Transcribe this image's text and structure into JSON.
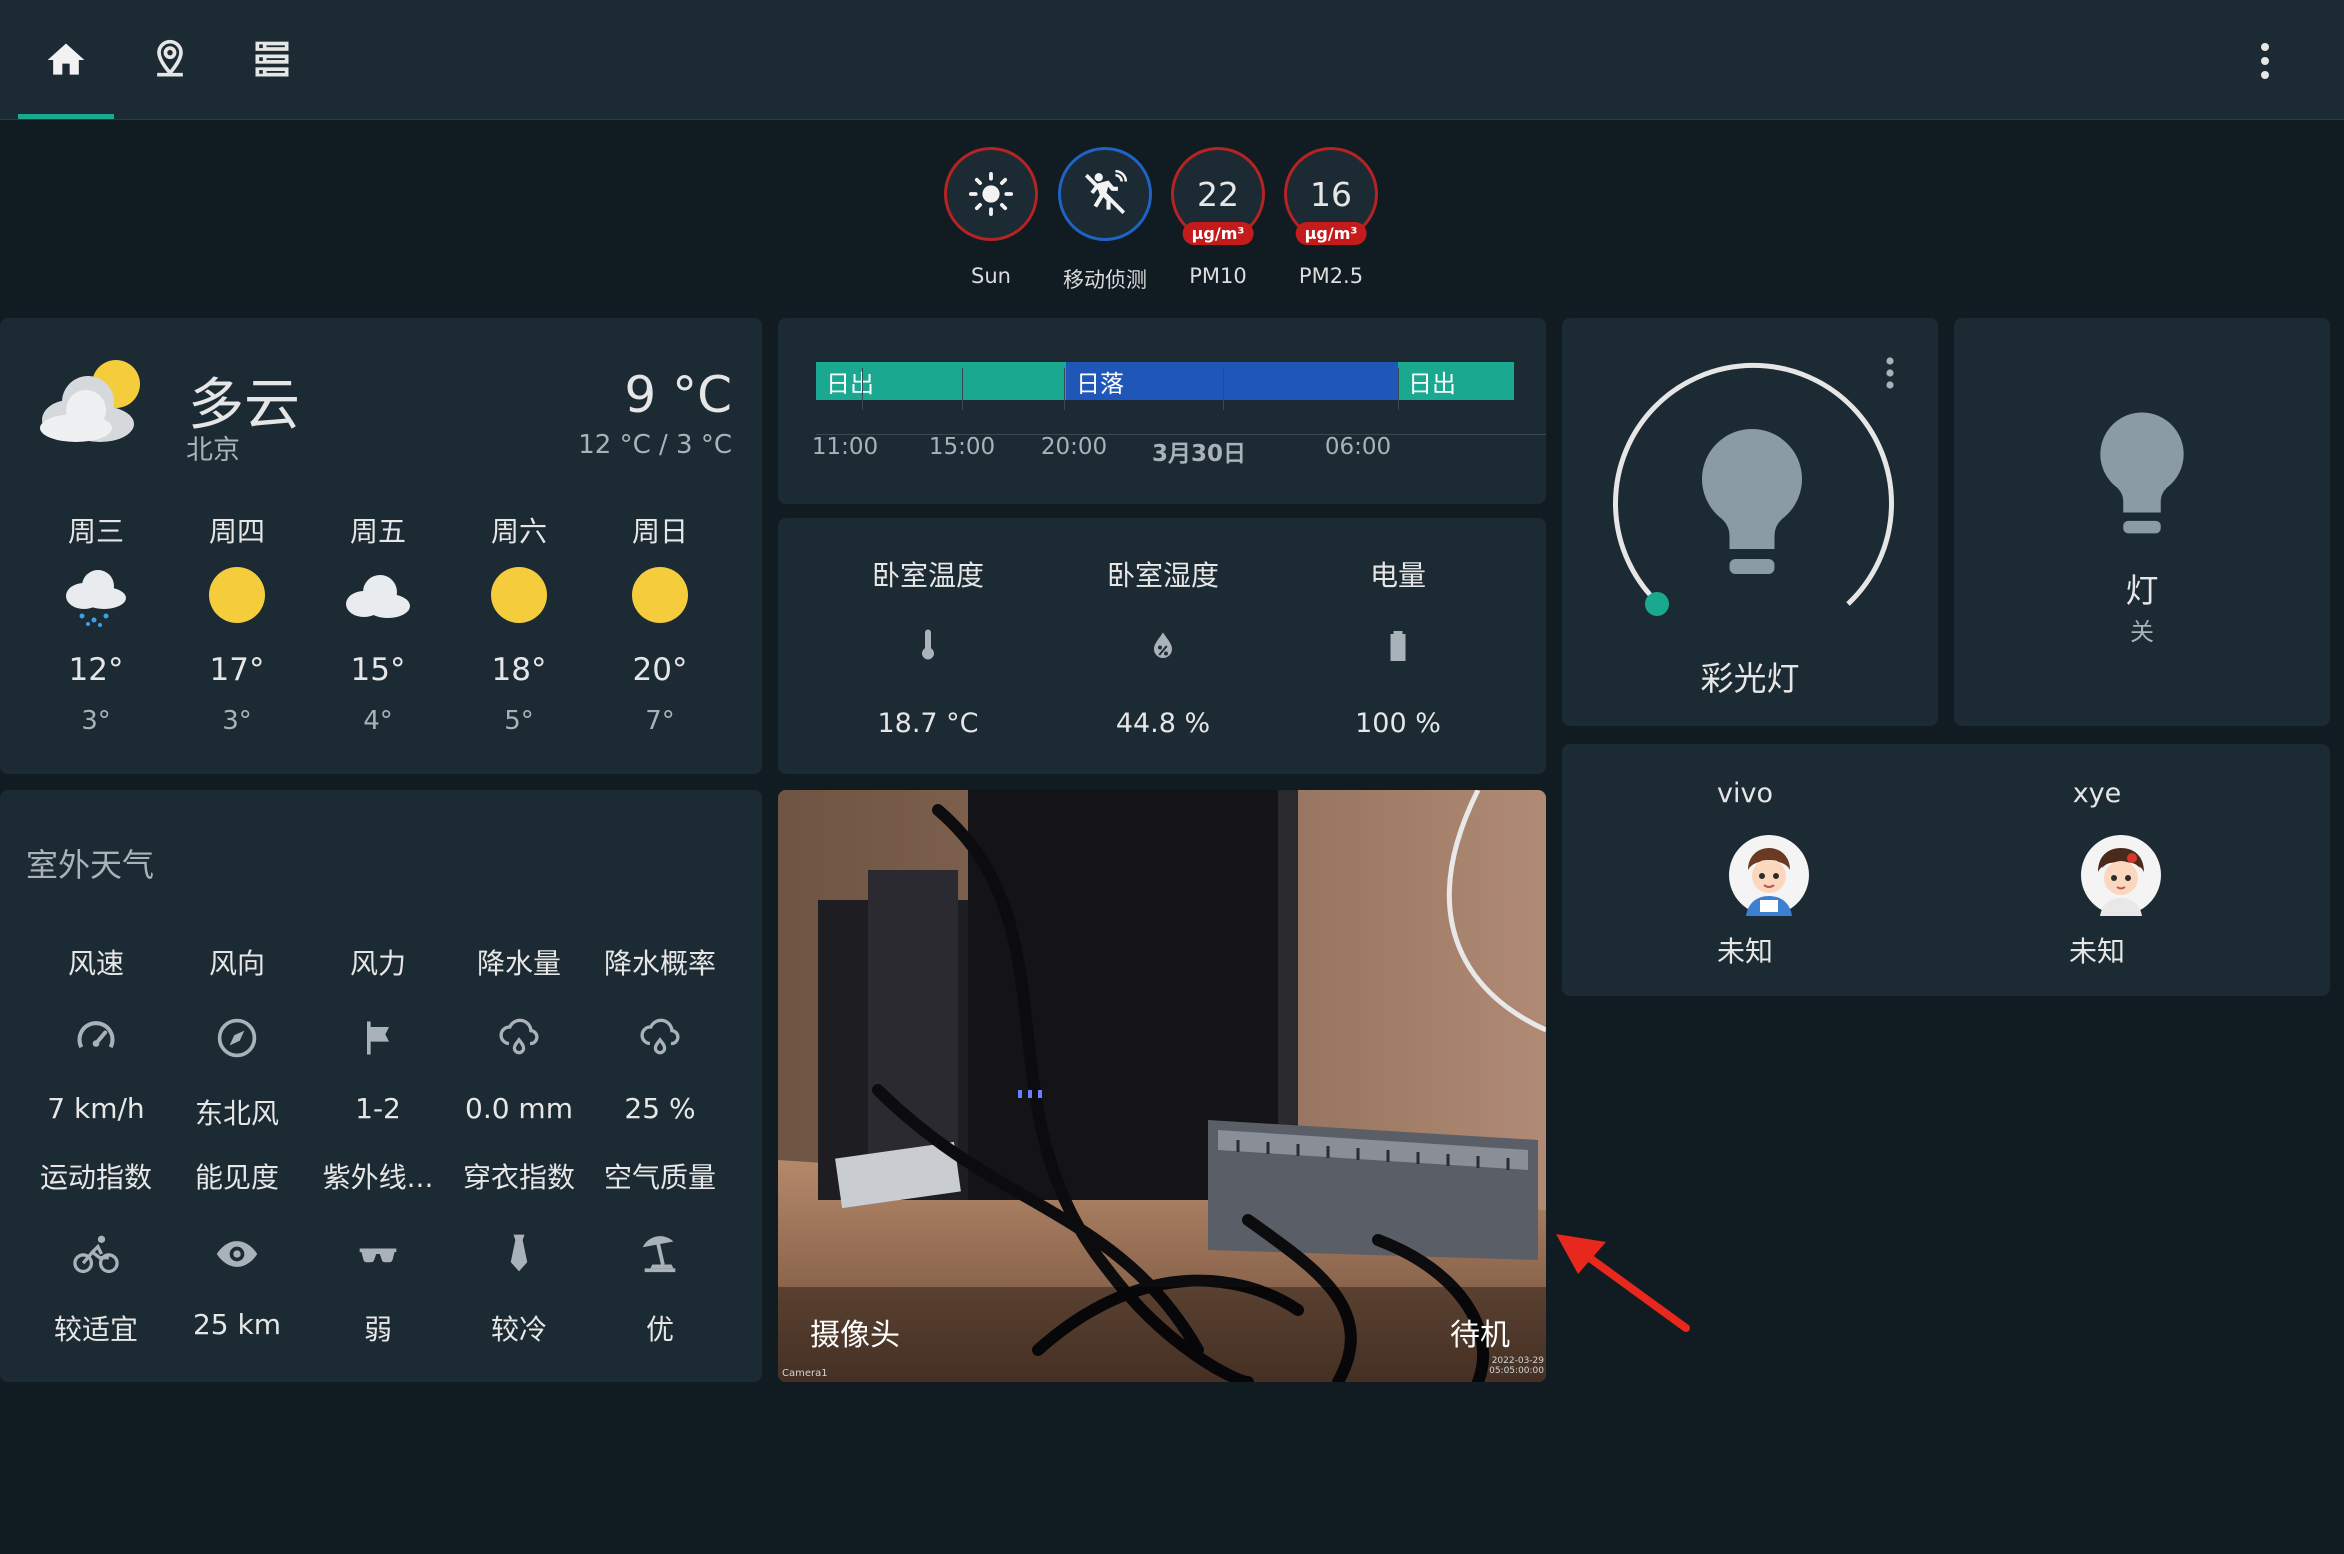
{
  "nav": {
    "tabs": [
      {
        "name": "home-icon",
        "active": true
      },
      {
        "name": "map-marker-icon",
        "active": false
      },
      {
        "name": "server-icon",
        "active": false
      }
    ],
    "menu_icon": "dots-vertical-icon"
  },
  "badges": [
    {
      "icon": "sun-icon",
      "label": "Sun",
      "border": "#b52323"
    },
    {
      "icon": "motion-sensor-icon",
      "label": "移动侦测",
      "border": "#1f63c4"
    },
    {
      "value": "22",
      "unit": "µg/m³",
      "label": "PM10",
      "border": "#b52323"
    },
    {
      "value": "16",
      "unit": "µg/m³",
      "label": "PM2.5",
      "border": "#b52323"
    }
  ],
  "weather": {
    "icon": "partly-cloudy-icon",
    "condition": "多云",
    "location": "北京",
    "temperature": "9",
    "temp_unit": "°C",
    "high_low": "12 °C / 3 °C",
    "forecast": [
      {
        "day": "周三",
        "icon": "rain-icon",
        "high": "12°",
        "low": "3°"
      },
      {
        "day": "周四",
        "icon": "sunny-icon",
        "high": "17°",
        "low": "3°"
      },
      {
        "day": "周五",
        "icon": "cloudy-icon",
        "high": "15°",
        "low": "4°"
      },
      {
        "day": "周六",
        "icon": "sunny-icon",
        "high": "18°",
        "low": "5°"
      },
      {
        "day": "周日",
        "icon": "sunny-icon",
        "high": "20°",
        "low": "7°"
      }
    ]
  },
  "outdoor": {
    "title": "室外天气",
    "row1": [
      {
        "label": "风速",
        "icon": "gauge-icon",
        "value": "7 km/h"
      },
      {
        "label": "风向",
        "icon": "compass-icon",
        "value": "东北风"
      },
      {
        "label": "风力",
        "icon": "flag-icon",
        "value": "1-2"
      },
      {
        "label": "降水量",
        "icon": "rain-cloud-icon",
        "value": "0.0 mm"
      },
      {
        "label": "降水概率",
        "icon": "rain-cloud-icon",
        "value": "25 %"
      }
    ],
    "row2": [
      {
        "label": "运动指数",
        "icon": "bike-icon",
        "value": "较适宜"
      },
      {
        "label": "能见度",
        "icon": "eye-icon",
        "value": "25 km"
      },
      {
        "label": "紫外线...",
        "icon": "sunglasses-icon",
        "value": "弱"
      },
      {
        "label": "穿衣指数",
        "icon": "tie-icon",
        "value": "较冷"
      },
      {
        "label": "空气质量",
        "icon": "beach-umbrella-icon",
        "value": "优"
      }
    ]
  },
  "timeline": {
    "segments": [
      {
        "label": "日出",
        "color": "#1aa890"
      },
      {
        "label": "日落",
        "color": "#1f57b8"
      },
      {
        "label": "日出",
        "color": "#1aa890"
      }
    ],
    "ticks": [
      "11:00",
      "15:00",
      "20:00",
      "3月30日",
      "06:00"
    ]
  },
  "sensors": [
    {
      "label": "卧室温度",
      "icon": "thermometer-icon",
      "value": "18.7 °C"
    },
    {
      "label": "卧室湿度",
      "icon": "water-percent-icon",
      "value": "44.8 %"
    },
    {
      "label": "电量",
      "icon": "battery-icon",
      "value": "100 %"
    }
  ],
  "camera": {
    "name": "摄像头",
    "state": "待机",
    "overlay_tl": "Camera1",
    "overlay_time": "2022-03-29 05:05:00:00"
  },
  "lights": {
    "color_light": {
      "name": "彩光灯",
      "icon": "lightbulb-icon",
      "colors": {
        "ring": "#e6e6e6",
        "handle": "#1aa890",
        "bulb": "#8a9ba6"
      }
    },
    "light": {
      "name": "灯",
      "state": "关",
      "icon": "lightbulb-icon"
    }
  },
  "persons": [
    {
      "name": "vivo",
      "state": "未知",
      "avatar": "avatar-icon"
    },
    {
      "name": "xye",
      "state": "未知",
      "avatar": "avatar-icon"
    }
  ],
  "colors": {
    "accent": "#1aa890",
    "card": "#1c2a33",
    "background": "#111b22",
    "alert": "#b52323",
    "arrow": "#e8271d"
  }
}
